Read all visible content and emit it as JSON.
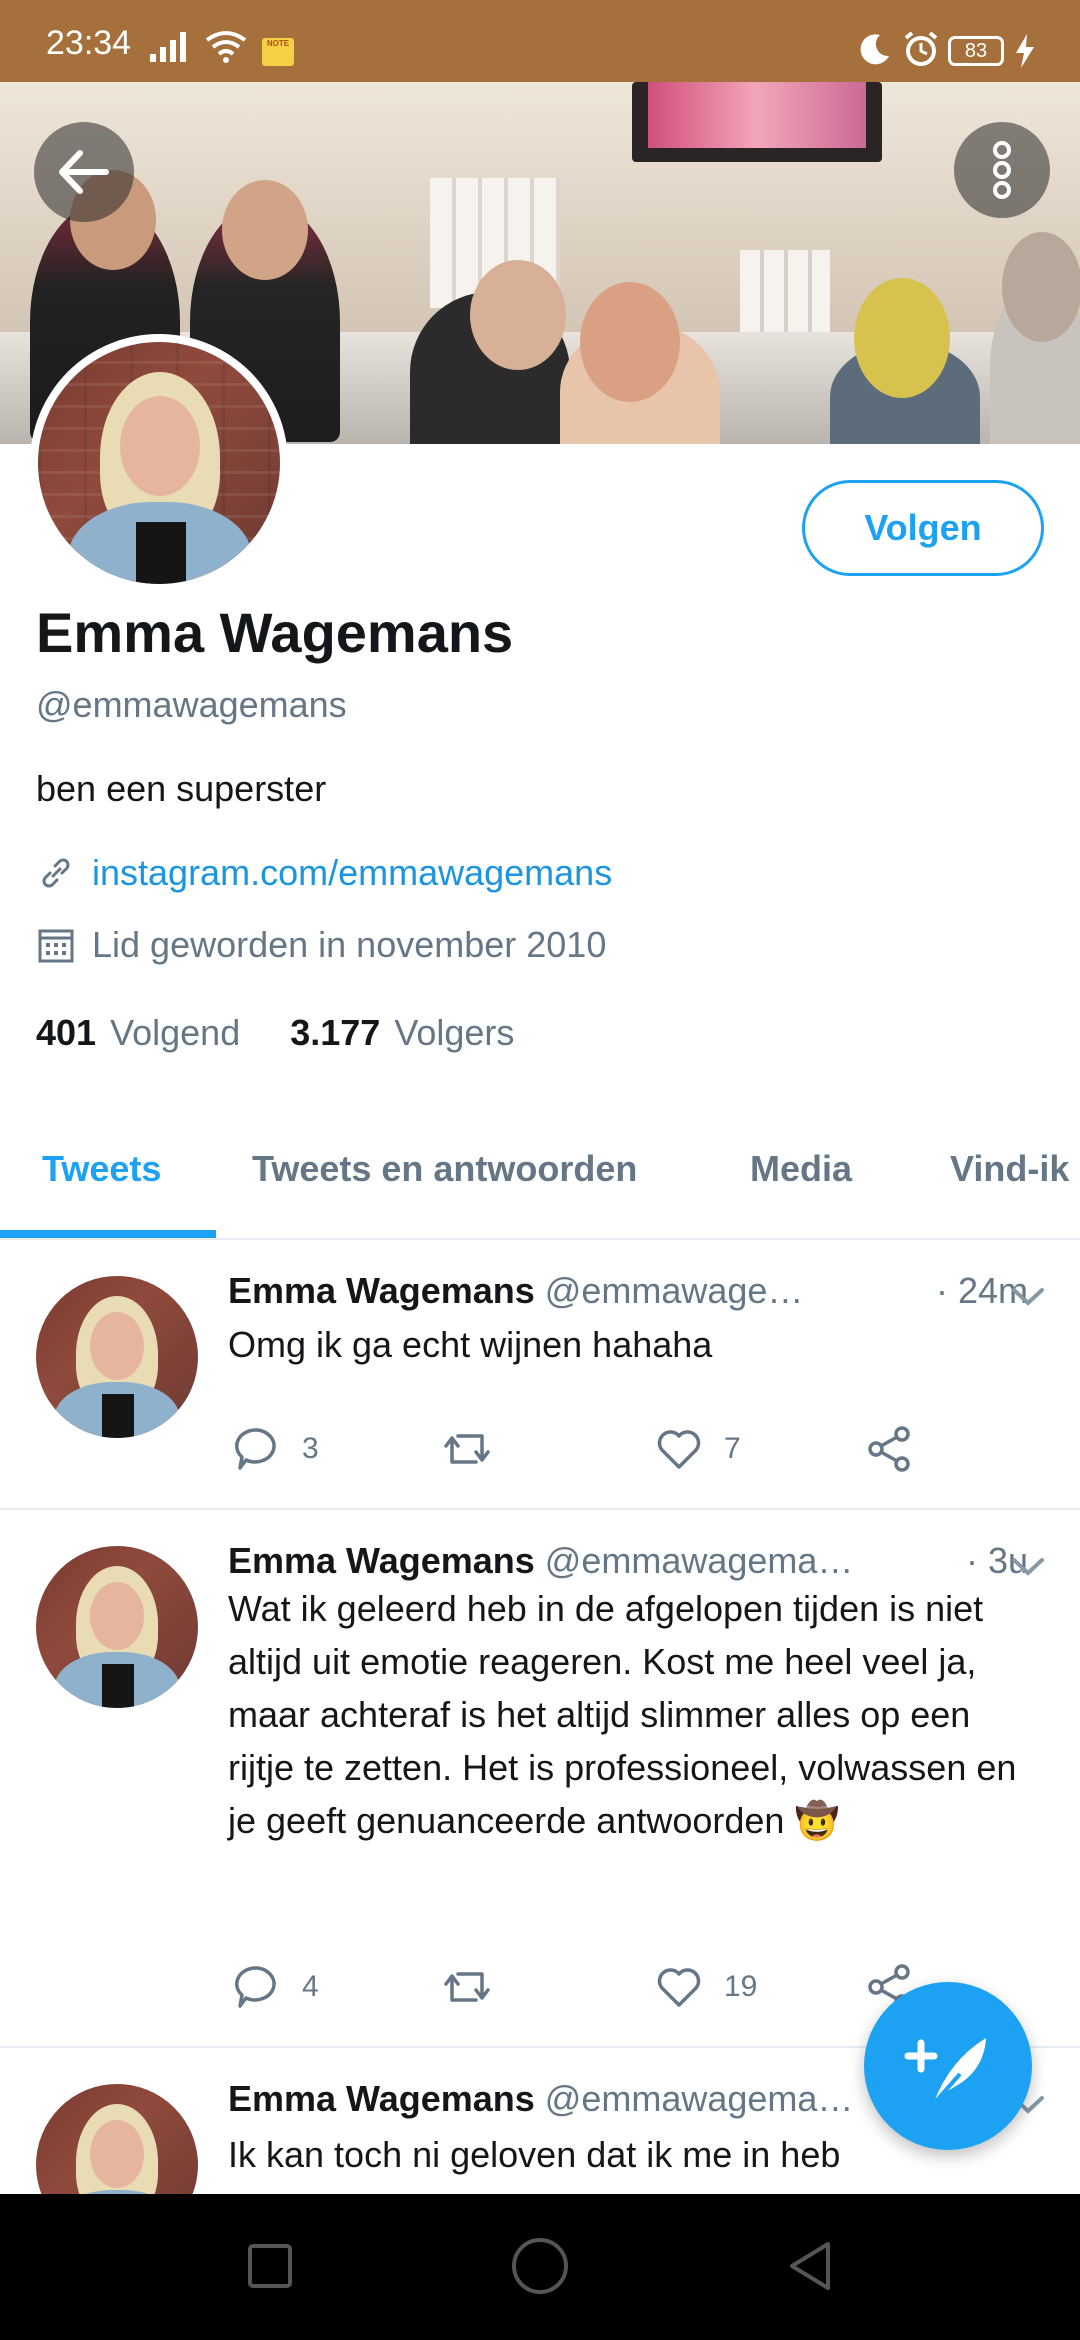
{
  "status_bar": {
    "time": "23:34",
    "battery": "83",
    "note_label": "NOTE",
    "icons": [
      "signal-icon",
      "wifi-icon",
      "note-icon",
      "moon-icon",
      "alarm-icon",
      "battery-icon",
      "charging-icon"
    ]
  },
  "header": {
    "back_icon": "arrow-left-icon",
    "more_icon": "more-vertical-icon"
  },
  "profile": {
    "name": "Emma Wagemans",
    "handle": "@emmawagemans",
    "bio": "ben een superster",
    "link": "instagram.com/emmawagemans",
    "joined": "Lid geworden in november 2010",
    "following_count": "401",
    "following_label": "Volgend",
    "followers_count": "3.177",
    "followers_label": "Volgers",
    "follow_button": "Volgen"
  },
  "tabs": [
    {
      "label": "Tweets",
      "active": true
    },
    {
      "label": "Tweets en antwoorden",
      "active": false
    },
    {
      "label": "Media",
      "active": false
    },
    {
      "label": "Vind-ik",
      "active": false
    }
  ],
  "tweets": [
    {
      "name": "Emma Wagemans",
      "handle": "@emmawage…",
      "time": "· 24m",
      "text": "Omg ik ga echt wijnen hahaha",
      "replies": "3",
      "retweets": "",
      "likes": "7"
    },
    {
      "name": "Emma Wagemans",
      "handle": "@emmawagema…",
      "time": "· 3u",
      "text": "Wat ik geleerd heb in de afgelopen tijden is niet altijd uit emotie reageren. Kost me heel veel ja, maar achteraf is het altijd slimmer alles op een rijtje te zetten. Het is professioneel, volwassen en je geeft genuanceerde antwoorden 🤠",
      "replies": "4",
      "retweets": "",
      "likes": "19"
    },
    {
      "name": "Emma Wagemans",
      "handle": "@emmawagema…",
      "time": "",
      "text": "Ik kan toch ni geloven dat ik me in heb"
    }
  ],
  "colors": {
    "accent": "#1da1f2",
    "status_bar": "#a5703c",
    "secondary_text": "#657786"
  }
}
